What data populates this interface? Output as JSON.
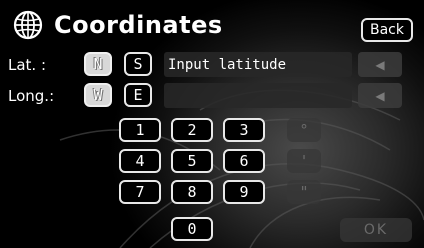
{
  "header": {
    "title": "Coordinates",
    "back_label": "Back",
    "icon": "globe-icon"
  },
  "latitude": {
    "label": "Lat. :",
    "north_label": "N",
    "south_label": "S",
    "north_selected": true,
    "field_value": "Input latitude",
    "arrow_icon": "left-arrow-icon"
  },
  "longitude": {
    "label": "Long.:",
    "west_label": "W",
    "east_label": "E",
    "west_selected": true,
    "field_value": "",
    "arrow_icon": "left-arrow-icon"
  },
  "keypad": {
    "keys": [
      "1",
      "2",
      "3",
      "4",
      "5",
      "6",
      "7",
      "8",
      "9",
      "0"
    ],
    "symbols": [
      "°",
      "'",
      "\""
    ],
    "ok_label": "OK"
  },
  "colors": {
    "background": "#000000",
    "button_border": "#e8e8e8",
    "disabled": "#373737"
  }
}
